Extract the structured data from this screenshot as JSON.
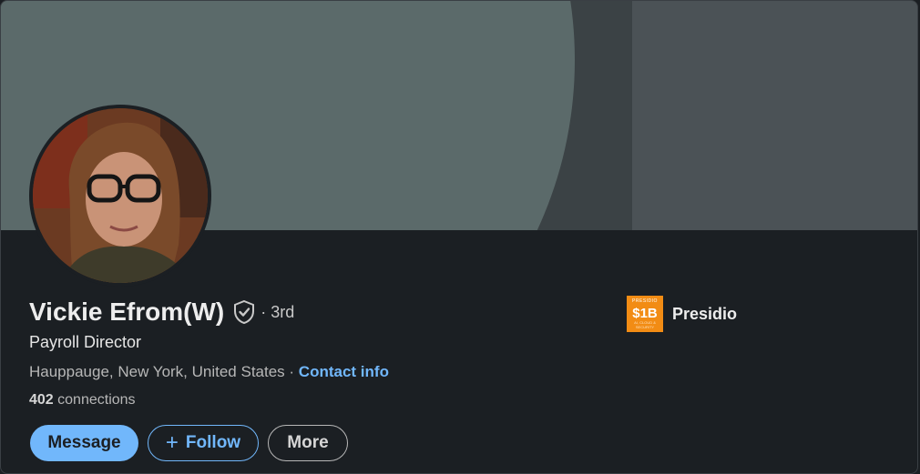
{
  "profile": {
    "name": "Vickie Efrom(W)",
    "degree": "· 3rd",
    "headline": "Payroll Director",
    "location": "Hauppauge, New York, United States",
    "separator": " · ",
    "contact_info": "Contact info",
    "connections_count": "402",
    "connections_label": " connections"
  },
  "company": {
    "name": "Presidio",
    "logo_top": "PRESIDIO",
    "logo_big": "$1B",
    "logo_bottom": "AI, CLOUD & SECURITY"
  },
  "actions": {
    "message": "Message",
    "follow": "Follow",
    "follow_icon": "+",
    "more": "More"
  },
  "icons": {
    "verified": "shield-check-icon"
  },
  "colors": {
    "accent": "#71b7fb",
    "background": "#1b1f23",
    "company_logo": "#f28c14"
  }
}
